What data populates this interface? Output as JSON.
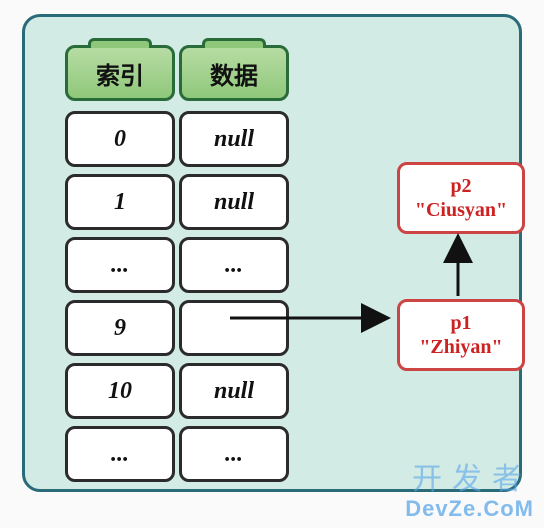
{
  "headers": {
    "index": "索引",
    "data": "数据"
  },
  "rows": [
    {
      "idx": "0",
      "val": "null"
    },
    {
      "idx": "1",
      "val": "null"
    },
    {
      "idx": "...",
      "val": "..."
    },
    {
      "idx": "9",
      "val": ""
    },
    {
      "idx": "10",
      "val": "null"
    },
    {
      "idx": "...",
      "val": "..."
    }
  ],
  "nodes": {
    "p1": {
      "label": "p1",
      "value": "\"Zhiyan\""
    },
    "p2": {
      "label": "p2",
      "value": "\"Ciusyan\""
    }
  },
  "watermark": {
    "cn": "开发者",
    "en": "DevZe.CoM"
  }
}
